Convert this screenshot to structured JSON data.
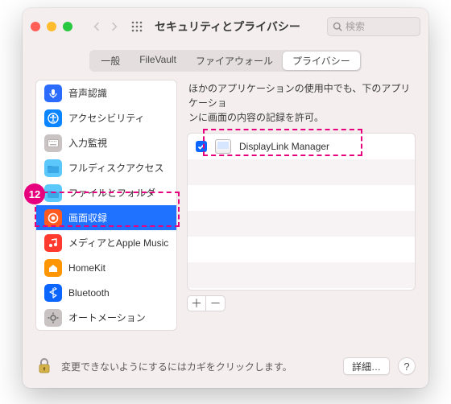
{
  "window": {
    "title": "セキュリティとプライバシー"
  },
  "search": {
    "placeholder": "検索"
  },
  "tabs": {
    "general": "一般",
    "filevault": "FileVault",
    "firewall": "ファイアウォール",
    "privacy": "プライバシー"
  },
  "sidebar": {
    "items": [
      {
        "label": "音声認識",
        "icon": "mic"
      },
      {
        "label": "アクセシビリティ",
        "icon": "accessibility"
      },
      {
        "label": "入力監視",
        "icon": "keyboard"
      },
      {
        "label": "フルディスクアクセス",
        "icon": "folder"
      },
      {
        "label": "ファイルとフォルダ",
        "icon": "folder"
      },
      {
        "label": "画面収録",
        "icon": "record",
        "selected": true
      },
      {
        "label": "メディアとApple Music",
        "icon": "music"
      },
      {
        "label": "HomeKit",
        "icon": "home"
      },
      {
        "label": "Bluetooth",
        "icon": "bluetooth"
      },
      {
        "label": "オートメーション",
        "icon": "automation"
      }
    ]
  },
  "content": {
    "desc_line1": "ほかのアプリケーションの使用中でも、下のアプリケーショ",
    "desc_line2": "ンに画面の内容の記録を許可。",
    "apps": [
      {
        "name": "DisplayLink Manager",
        "checked": true
      }
    ],
    "plus": "＋",
    "minus": "－"
  },
  "footer": {
    "lock_text": "変更できないようにするにはカギをクリックします。",
    "details": "詳細…",
    "help": "?"
  },
  "annotation": {
    "step": "12"
  }
}
